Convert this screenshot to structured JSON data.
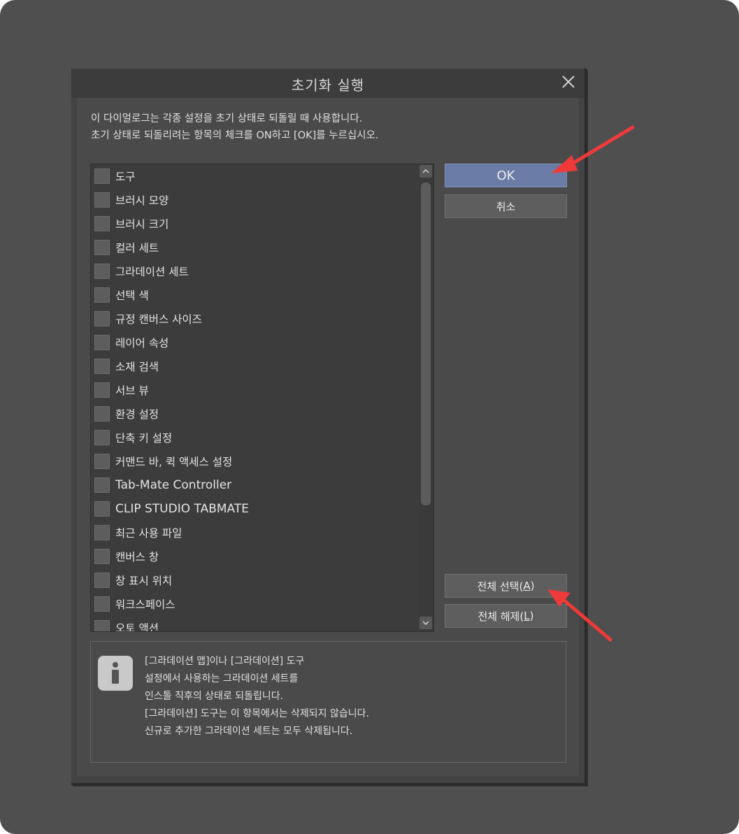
{
  "dialog": {
    "title": "초기화 실행",
    "description_line1": "이 다이얼로그는 각종 설정을 초기 상태로 되돌릴 때 사용합니다.",
    "description_line2": "초기 상태로 되돌리려는 항목의 체크를 ON하고 [OK]를 누르십시오."
  },
  "items": [
    {
      "label": "도구",
      "checked": false
    },
    {
      "label": "브러시 모양",
      "checked": false
    },
    {
      "label": "브러시 크기",
      "checked": false
    },
    {
      "label": "컬러 세트",
      "checked": false
    },
    {
      "label": "그라데이션 세트",
      "checked": false
    },
    {
      "label": "선택 색",
      "checked": false
    },
    {
      "label": "규정 캔버스 사이즈",
      "checked": false
    },
    {
      "label": "레이어 속성",
      "checked": false
    },
    {
      "label": "소재 검색",
      "checked": false
    },
    {
      "label": "서브 뷰",
      "checked": false
    },
    {
      "label": "환경 설정",
      "checked": false
    },
    {
      "label": "단축 키 설정",
      "checked": false
    },
    {
      "label": "커맨드 바, 퀵 액세스 설정",
      "checked": false
    },
    {
      "label": "Tab-Mate Controller",
      "checked": false
    },
    {
      "label": "CLIP STUDIO TABMATE",
      "checked": false
    },
    {
      "label": "최근 사용 파일",
      "checked": false
    },
    {
      "label": "캔버스 창",
      "checked": false
    },
    {
      "label": "창 표시 위치",
      "checked": false
    },
    {
      "label": "워크스페이스",
      "checked": false
    },
    {
      "label": "오토 액션",
      "checked": false
    }
  ],
  "buttons": {
    "ok": "OK",
    "cancel": "취소",
    "select_all": "전체 선택(",
    "select_all_key": "A",
    "deselect_all": "전체 해제(",
    "deselect_all_key": "L",
    "close_paren": ")"
  },
  "info": {
    "line1": "[그라데이션 맵]이나 [그라데이션] 도구",
    "line2": "설정에서 사용하는 그라데이션 세트를",
    "line3": "인스톨 직후의 상태로 되돌립니다.",
    "line4": "[그라데이션] 도구는 이 항목에서는 삭제되지 않습니다.",
    "line5": "신규로 추가한 그라데이션 세트는 모두 삭제됩니다."
  },
  "colors": {
    "ok_button": "#6b7ca6",
    "annotation_arrow": "#f03a3a"
  }
}
